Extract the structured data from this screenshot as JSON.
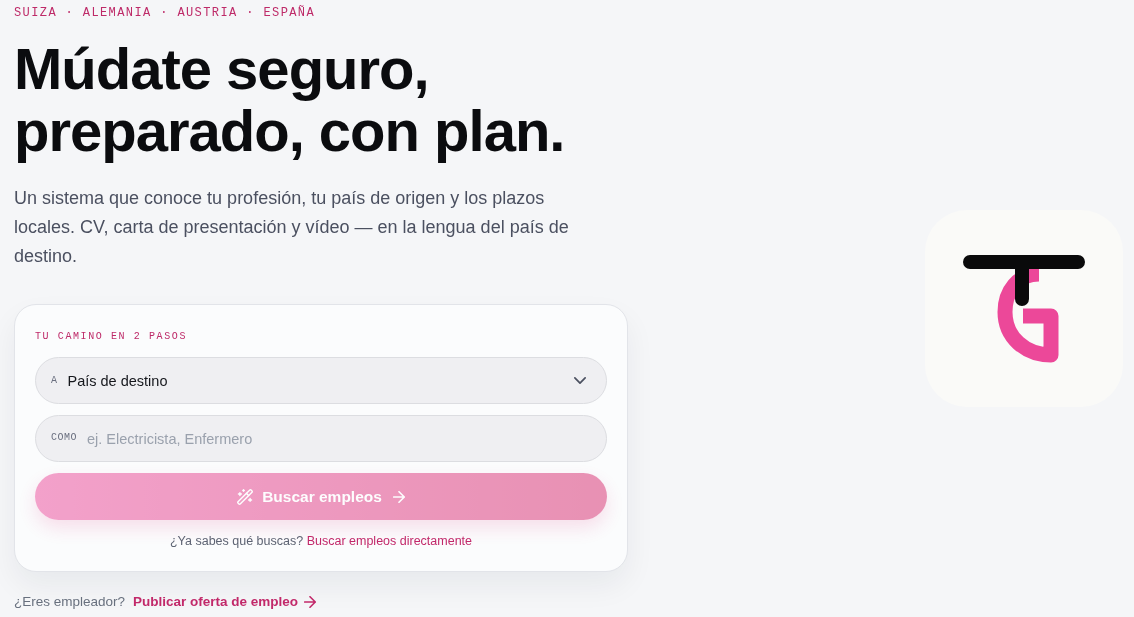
{
  "eyebrow": "SUIZA · ALEMANIA · AUSTRIA · ESPAÑA",
  "headline": "Múdate seguro,\npreparado, con plan.",
  "intro": "Un sistema que conoce tu profesión, tu país de origen y los plazos locales. CV, carta de presentación y vídeo — en la lengua del país de destino.",
  "search_card": {
    "step_label": "TU CAMINO EN 2 PASOS",
    "fields": [
      {
        "kind": "select",
        "prefix": "A",
        "value": "País de destino"
      },
      {
        "kind": "text",
        "prefix": "COMO",
        "placeholder": "ej. Electricista, Enfermero"
      }
    ],
    "submit_button": {
      "label": "Buscar empleos",
      "disabled": true
    },
    "hint": {
      "text": "¿Ya sabes qué buscas?",
      "link": "Buscar empleos directamente"
    }
  },
  "employer": {
    "text": "¿Eres empleador?",
    "link": "Publicar oferta de empleo"
  }
}
